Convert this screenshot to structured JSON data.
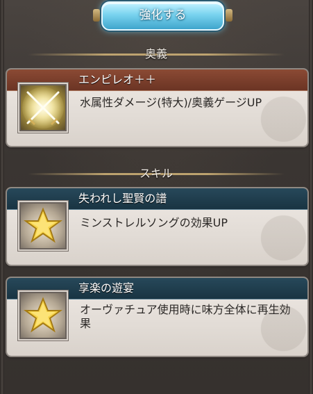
{
  "top_button": {
    "label": "強化する"
  },
  "sections": {
    "ougi": {
      "title": "奥義"
    },
    "skill": {
      "title": "スキル"
    }
  },
  "ougi_card": {
    "name": "エンピレオ＋＋",
    "description": "水属性ダメージ(特大)/奥義ゲージUP",
    "icon": "crossed-swords-icon"
  },
  "skills": [
    {
      "name": "失われし聖賢の譜",
      "description": "ミンストレルソングの効果UP",
      "icon": "star-icon"
    },
    {
      "name": "享楽の遊宴",
      "description": "オーヴァチュア使用時に味方全体に再生効果",
      "icon": "star-icon"
    }
  ],
  "colors": {
    "ougi_header": "#7a3f2c",
    "skill_header": "#1f3d4d",
    "button_accent": "#6fd0ef"
  }
}
